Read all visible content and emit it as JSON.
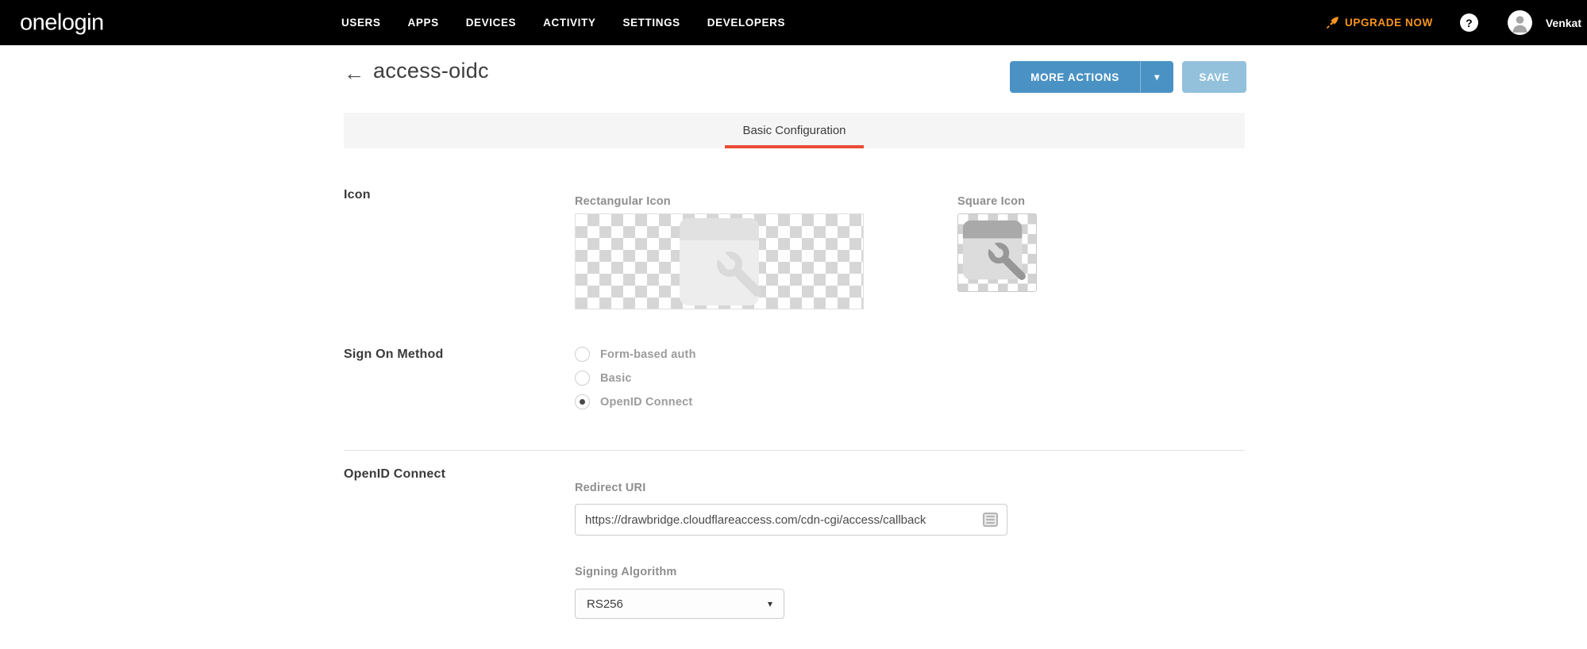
{
  "nav": {
    "logo": "onelogin",
    "items": [
      "USERS",
      "APPS",
      "DEVICES",
      "ACTIVITY",
      "SETTINGS",
      "DEVELOPERS"
    ],
    "upgrade_label": "UPGRADE NOW",
    "help_glyph": "?",
    "user": "Venkat"
  },
  "header": {
    "back_glyph": "←",
    "title": "access-oidc",
    "more_actions_label": "MORE ACTIONS",
    "caret_glyph": "▾",
    "save_label": "SAVE"
  },
  "tabs": [
    {
      "label": "Basic Configuration",
      "active": true
    }
  ],
  "icon_section": {
    "label": "Icon",
    "rectangular_label": "Rectangular Icon",
    "square_label": "Square Icon"
  },
  "sign_on_section": {
    "label": "Sign On Method",
    "options": [
      {
        "label": "Form-based auth",
        "selected": false
      },
      {
        "label": "Basic",
        "selected": false
      },
      {
        "label": "OpenID Connect",
        "selected": true
      }
    ]
  },
  "oidc_section": {
    "label": "OpenID Connect",
    "redirect_uri": {
      "label": "Redirect URI",
      "value": "https://drawbridge.cloudflareaccess.com/cdn-cgi/access/callback"
    },
    "signing_algorithm": {
      "label": "Signing Algorithm",
      "value": "RS256",
      "caret_glyph": "▾"
    }
  },
  "colors": {
    "nav_bg": "#000000",
    "accent_blue": "#4A92C4",
    "save_blue": "#93C1DC",
    "tab_underline": "#EA4C35",
    "upgrade_orange": "#F7941D"
  }
}
